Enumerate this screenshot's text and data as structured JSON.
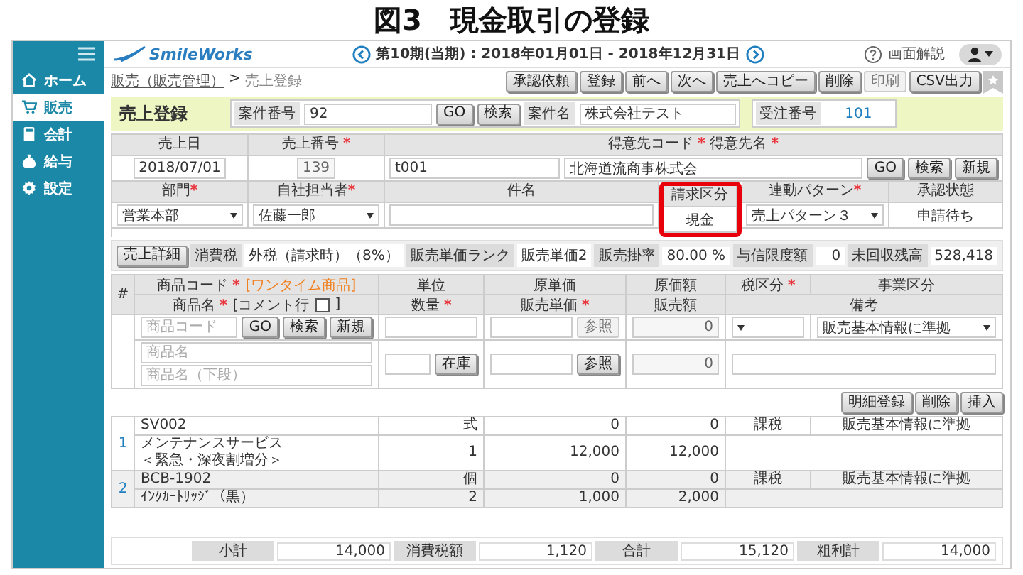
{
  "page_title": "図3　現金取引の登録",
  "app": {
    "logo": "SmileWorks",
    "period": "第10期(当期) : 2018年01月01日 - 2018年12月31日",
    "help_label": "画面解説"
  },
  "sidebar": {
    "items": [
      {
        "label": "ホーム",
        "selected": false
      },
      {
        "label": "販売",
        "selected": true
      },
      {
        "label": "会計",
        "selected": false
      },
      {
        "label": "給与",
        "selected": false
      },
      {
        "label": "設定",
        "selected": false
      }
    ]
  },
  "breadcrumb": {
    "link": "販売（販売管理）",
    "separator": ">",
    "current": "売上登録"
  },
  "toolbar": [
    {
      "label": "承認依頼",
      "disabled": false
    },
    {
      "label": "登録",
      "disabled": false
    },
    {
      "label": "前へ",
      "disabled": false
    },
    {
      "label": "次へ",
      "disabled": false
    },
    {
      "label": "売上へコピー",
      "disabled": false
    },
    {
      "label": "削除",
      "disabled": false
    },
    {
      "label": "印刷",
      "disabled": true
    },
    {
      "label": "CSV出力",
      "disabled": false
    }
  ],
  "header": {
    "title": "売上登録",
    "project_no_label": "案件番号",
    "project_no": "92",
    "buttons": [
      "GO",
      "検索"
    ],
    "project_name_label": "案件名",
    "project_name": "株式会社テスト",
    "order_no_label": "受注番号",
    "order_no": "101"
  },
  "form": {
    "sales_date": {
      "label": "売上日",
      "value": "2018/07/01"
    },
    "sales_no": {
      "label": "売上番号",
      "required_mark": "*",
      "value": "139"
    },
    "customer": {
      "label": "得意先コード",
      "required_mark": "*",
      "label2": "得意先名",
      "required_mark2": "*",
      "code": "t001",
      "name": "北海道流商事株式会",
      "buttons": [
        "GO",
        "検索",
        "新規"
      ]
    },
    "fields": [
      {
        "kind": "select",
        "label": "部門",
        "required_mark": "*",
        "value": "営業本部",
        "highlighted": false
      },
      {
        "kind": "select",
        "label": "自社担当者",
        "required_mark": "*",
        "value": "佐藤一郎",
        "highlighted": false
      },
      {
        "kind": "input",
        "label": "件名",
        "highlighted": false
      },
      {
        "kind": "text",
        "label": "請求区分",
        "value": "現金",
        "highlighted": true
      },
      {
        "kind": "select",
        "label": "連動パターン",
        "required_mark": "*",
        "value": "売上パターン３",
        "highlighted": false
      },
      {
        "kind": "text",
        "label": "承認状態",
        "value": "申請待ち",
        "highlighted": false
      }
    ]
  },
  "detail_bar": {
    "button": "売上詳細",
    "cells": [
      {
        "label": "消費税",
        "value": "外税（請求時）（8%）"
      },
      {
        "label": "販売単価ランク",
        "value": "販売単価2"
      },
      {
        "label": "販売掛率",
        "value": "80.00 %"
      },
      {
        "label": "与信限度額",
        "value": "0"
      },
      {
        "label": "未回収残高",
        "value": "528,418"
      }
    ]
  },
  "item_table": {
    "number_header": "#",
    "code_header": "商品コード",
    "code_mark": "*",
    "onetime_note": "[ワンタイム商品]",
    "name_header": "商品名",
    "name_mark": "*",
    "comment_note": "[コメント行",
    "comment_checked": false,
    "comment_close": "]",
    "unit_header": "単位",
    "qty_header": "数量",
    "qty_mark": "*",
    "cost_price_header": "原単価",
    "price_header": "販売単価",
    "price_mark": "*",
    "cost_amount_header": "原価額",
    "amount_header": "販売額",
    "tax_header": "税区分",
    "tax_mark": "*",
    "remark_header": "備考",
    "business_header": "事業区分",
    "entry": {
      "code_placeholder": "商品コード",
      "buttons": [
        "GO",
        "検索",
        "新規"
      ],
      "name_placeholder": "商品名",
      "name2_placeholder": "商品名（下段）",
      "stock_button": "在庫",
      "ref_buttons": [
        {
          "label": "参照",
          "disabled": true
        },
        {
          "label": "参照",
          "disabled": false
        }
      ],
      "cost_amount": "0",
      "sales_amount": "0",
      "business": "販売基本情報に準拠"
    }
  },
  "row_buttons": [
    "明細登録",
    "削除",
    "挿入"
  ],
  "lines": [
    {
      "no": "1",
      "code": "SV002",
      "name_lines": [
        "メンテナンスサービス",
        "＜緊急・深夜割増分＞"
      ],
      "unit": "式",
      "qty": "1",
      "cost_price": "0",
      "price": "12,000",
      "cost_amount": "0",
      "amount": "12,000",
      "tax": "課税",
      "business": "販売基本情報に準拠"
    },
    {
      "no": "2",
      "code": "BCB-1902",
      "name_lines": [
        "ｲﾝｸｶｰﾄﾘｯｼﾞ（黒）"
      ],
      "unit": "個",
      "qty": "2",
      "cost_price": "0",
      "price": "1,000",
      "cost_amount": "0",
      "amount": "2,000",
      "tax": "課税",
      "business": "販売基本情報に準拠"
    }
  ],
  "totals": [
    {
      "label": "小計",
      "value": "14,000"
    },
    {
      "label": "消費税額",
      "value": "1,120"
    },
    {
      "label": "合計",
      "value": "15,120"
    },
    {
      "label": "粗利計",
      "value": "14,000"
    }
  ]
}
